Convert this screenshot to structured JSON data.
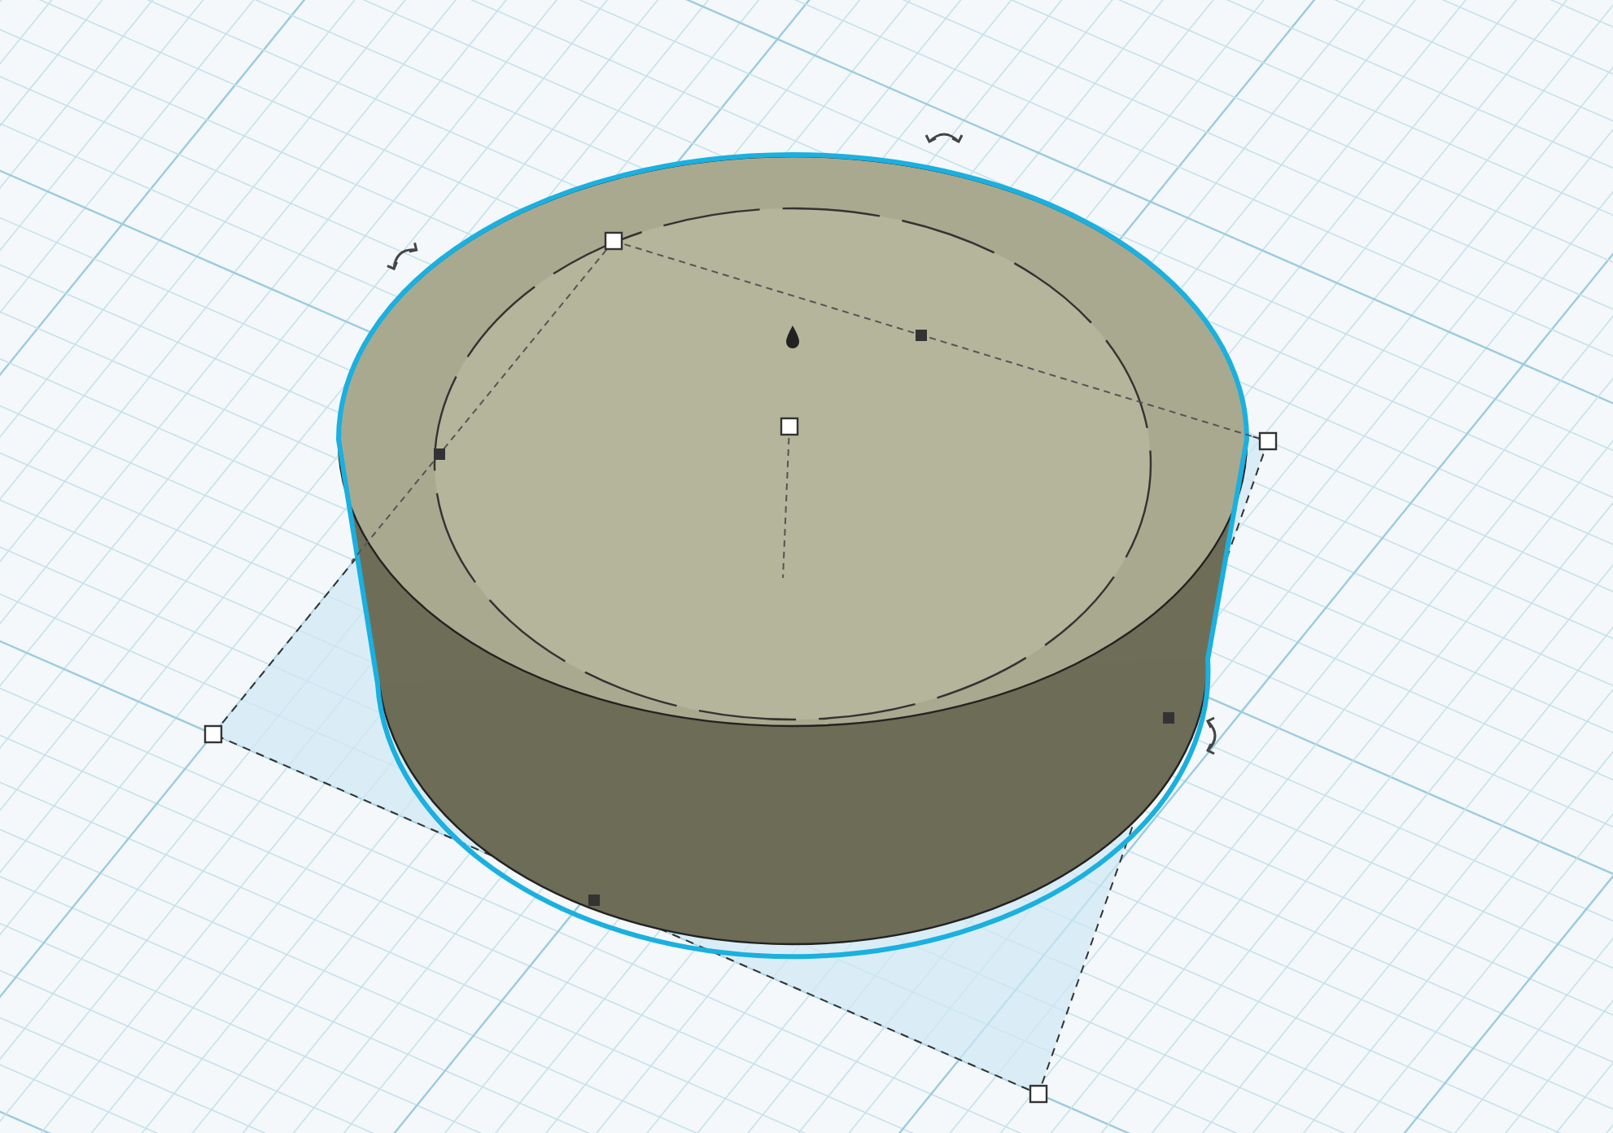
{
  "workplane": {
    "shapes": [
      {
        "kind": "cylinder",
        "selected": true
      }
    ]
  }
}
